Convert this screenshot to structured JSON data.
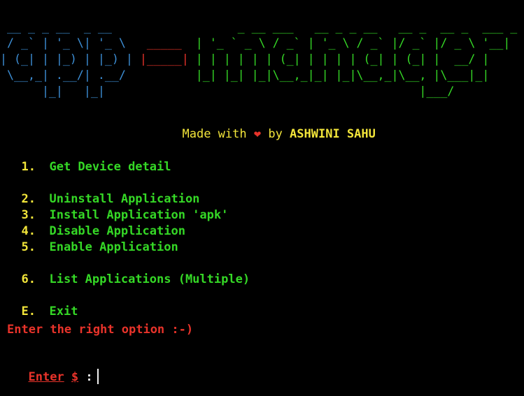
{
  "colors": {
    "blue": "#3d8fd6",
    "red": "#e8332a",
    "green": "#35d826",
    "yellow": "#f2e53a",
    "white": "#f0f0f0"
  },
  "banner": {
    "lines": [
      [
        {
          "t": " __ _ _ __  _ __           ",
          "c": "blue"
        },
        {
          "t": "",
          "c": "red"
        },
        {
          "t": "       _ __ ___   __ _ _ __   __ _  __ _  ___ _ __",
          "c": "green"
        }
      ],
      [
        {
          "t": " / _` | '_ \\| '_ \\  ",
          "c": "blue"
        },
        {
          "t": " _____ ",
          "c": "red"
        },
        {
          "t": " | '_ ` _ \\ / _` | '_ \\ / _` |/ _` |/ _ \\ '__|",
          "c": "green"
        }
      ],
      [
        {
          "t": "| (_| | |_) | |_) | ",
          "c": "blue"
        },
        {
          "t": "|_____|",
          "c": "red"
        },
        {
          "t": " | | | | | | (_| | | | | (_| | (_| |  __/ |",
          "c": "green"
        }
      ],
      [
        {
          "t": " \\__,_| .__/| .__/  ",
          "c": "blue"
        },
        {
          "t": "       ",
          "c": "red"
        },
        {
          "t": " |_| |_| |_|\\__,_|_| |_|\\__,_|\\__, |\\___|_|",
          "c": "green"
        }
      ],
      [
        {
          "t": "      |_|   |_|     ",
          "c": "blue"
        },
        {
          "t": "       ",
          "c": "red"
        },
        {
          "t": "                                 |___/",
          "c": "green"
        }
      ]
    ]
  },
  "credit": {
    "prefix": "Made with ",
    "heart": "❤",
    "middle": " by ",
    "author": "ASHWINI SAHU"
  },
  "menu": {
    "items": [
      {
        "key": "1.",
        "label": "Get Device detail"
      },
      {
        "key": "2.",
        "label": "Uninstall Application"
      },
      {
        "key": "3.",
        "label": "Install Application 'apk'"
      },
      {
        "key": "4.",
        "label": "Disable Application"
      },
      {
        "key": "5.",
        "label": "Enable Application"
      },
      {
        "key": "6.",
        "label": "List Applications (Multiple)"
      },
      {
        "key": "E.",
        "label": "Exit"
      }
    ]
  },
  "instruction": "Enter the right option :-)",
  "prompt": {
    "label": "Enter",
    "symbol": "$",
    "separator": " :"
  }
}
